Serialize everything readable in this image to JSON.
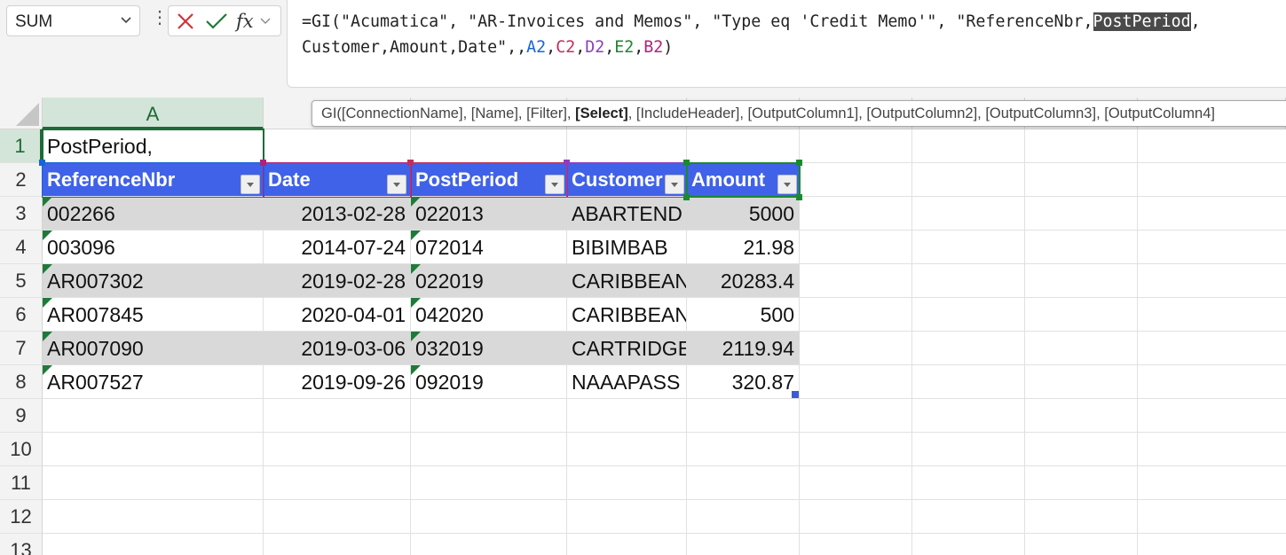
{
  "name_box": {
    "value": "SUM"
  },
  "formula_bar": {
    "fx_label": "fx",
    "parts": [
      {
        "text": "=GI(\"Acumatica\", \"AR-Invoices and Memos\", \"Type eq 'Credit Memo'\", \"ReferenceNbr,",
        "style": "plain"
      },
      {
        "text": "PostPeriod",
        "style": "hl"
      },
      {
        "text": ",",
        "style": "plain"
      }
    ],
    "line2": [
      {
        "text": "Customer,Amount,Date\",,",
        "style": "plain"
      },
      {
        "text": "A2",
        "style": "ra"
      },
      {
        "text": ",",
        "style": "plain"
      },
      {
        "text": "C2",
        "style": "rc"
      },
      {
        "text": ",",
        "style": "plain"
      },
      {
        "text": "D2",
        "style": "rd"
      },
      {
        "text": ",",
        "style": "plain"
      },
      {
        "text": "E2",
        "style": "re"
      },
      {
        "text": ",",
        "style": "plain"
      },
      {
        "text": "B2",
        "style": "rb"
      },
      {
        "text": ")",
        "style": "plain"
      }
    ]
  },
  "tooltip": {
    "prefix": "GI([ConnectionName], [Name], [Filter], ",
    "bold": "[Select]",
    "suffix": ", [IncludeHeader], [OutputColumn1], [OutputColumn2], [OutputColumn3], [OutputColumn4]"
  },
  "grid": {
    "column_headers": [
      "A"
    ],
    "row_headers": [
      "1",
      "2",
      "3",
      "4",
      "5",
      "6",
      "7",
      "8",
      "9",
      "10",
      "11",
      "12",
      "13"
    ],
    "a1": "PostPeriod,",
    "table_headers": [
      "ReferenceNbr",
      "Date",
      "PostPeriod",
      "Customer",
      "Amount"
    ],
    "rows": [
      [
        "002266",
        "2013-02-28",
        "022013",
        "ABARTEND",
        "5000"
      ],
      [
        "003096",
        "2014-07-24",
        "072014",
        "BIBIMBAB",
        "21.98"
      ],
      [
        "AR007302",
        "2019-02-28",
        "022019",
        "CARIBBEAN",
        "20283.4"
      ],
      [
        "AR007845",
        "2020-04-01",
        "042020",
        "CARIBBEAN",
        "500"
      ],
      [
        "AR007090",
        "2019-03-06",
        "032019",
        "CARTRIDGE",
        "2119.94"
      ],
      [
        "AR007527",
        "2019-09-26",
        "092019",
        "NAAAPASS",
        "320.87"
      ]
    ]
  },
  "colors": {
    "table_header": "#4062e8",
    "band": "#d9d9d9",
    "select_green": "#1d6b36"
  }
}
